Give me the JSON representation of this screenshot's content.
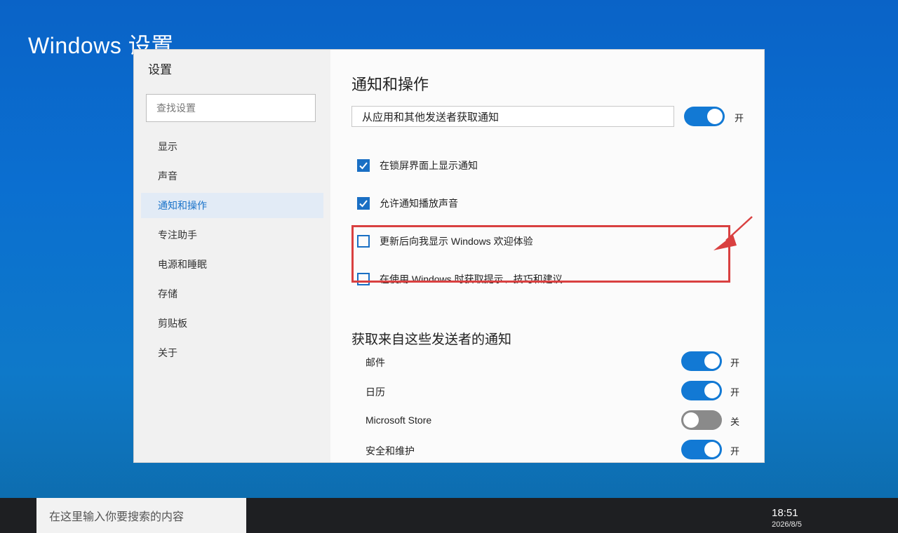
{
  "desktop": {
    "title": "Windows 设置"
  },
  "window": {
    "title": "设置",
    "search_placeholder": "查找设置"
  },
  "sidebar": {
    "items": [
      {
        "label": "显示"
      },
      {
        "label": "声音"
      },
      {
        "label": "通知和操作",
        "active": true
      },
      {
        "label": "专注助手"
      },
      {
        "label": "电源和睡眠"
      },
      {
        "label": "存储"
      },
      {
        "label": "剪贴板"
      },
      {
        "label": "关于"
      }
    ]
  },
  "main": {
    "heading": "通知和操作",
    "get_notifications": {
      "label": "从应用和其他发送者获取通知",
      "toggle_on": true,
      "state_label": "开"
    },
    "checkboxes": [
      {
        "label": "在锁屏界面上显示通知",
        "checked": true
      },
      {
        "label": "允许通知播放声音",
        "checked": true
      },
      {
        "label": "更新后向我显示 Windows 欢迎体验",
        "checked": false
      },
      {
        "label": "在使用 Windows 时获取提示、技巧和建议",
        "checked": false
      }
    ],
    "senders_heading": "获取来自这些发送者的通知",
    "senders": [
      {
        "name": "邮件",
        "on": true,
        "state_label": "开"
      },
      {
        "name": "日历",
        "on": true,
        "state_label": "开"
      },
      {
        "name": "Microsoft Store",
        "on": false,
        "state_label": "关"
      },
      {
        "name": "安全和维护",
        "on": true,
        "state_label": "开"
      }
    ]
  },
  "taskbar": {
    "search_placeholder": "在这里输入你要搜索的内容",
    "time": "18:51",
    "date": "2026/8/5"
  },
  "colors": {
    "accent": "#1279d4",
    "highlight": "#d94040",
    "toggle_off": "#8a8a8a"
  }
}
